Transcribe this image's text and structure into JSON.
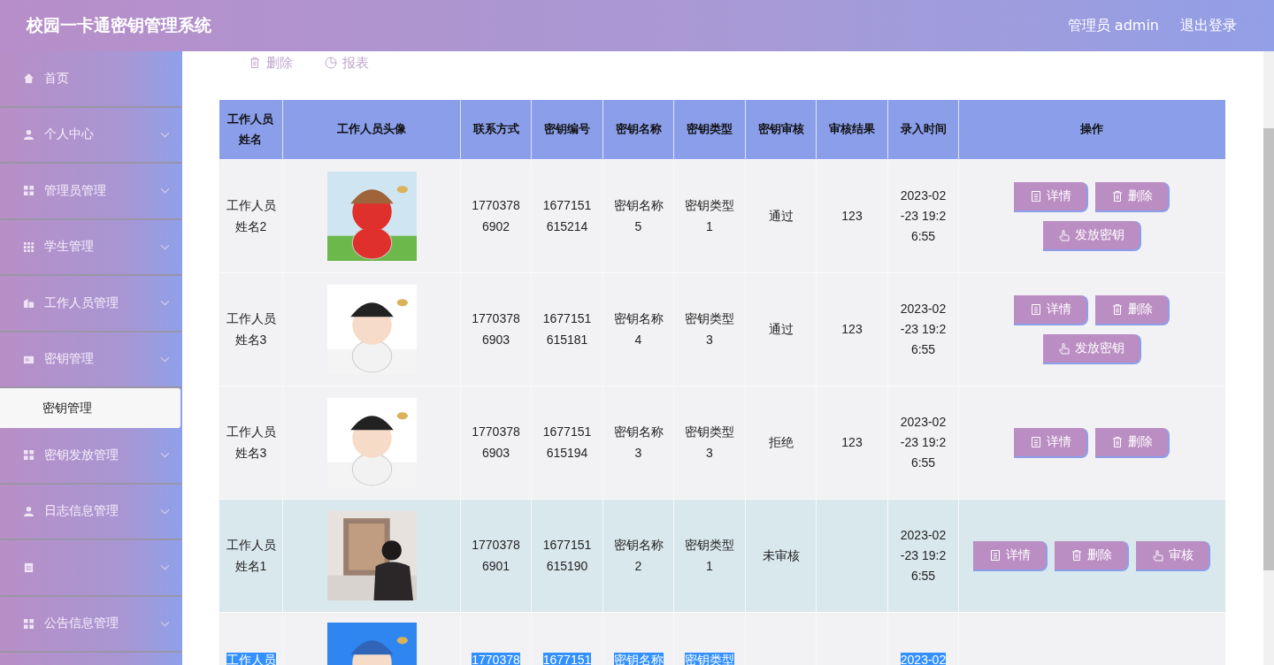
{
  "header": {
    "title": "校园一卡通密钥管理系统",
    "user": "管理员 admin",
    "logout": "退出登录"
  },
  "sidebar": {
    "items": [
      {
        "label": "首页",
        "kind": "link"
      },
      {
        "label": "个人中心",
        "kind": "menu"
      },
      {
        "label": "管理员管理",
        "kind": "menu"
      },
      {
        "label": "学生管理",
        "kind": "menu"
      },
      {
        "label": "工作人员管理",
        "kind": "menu"
      },
      {
        "label": "密钥管理",
        "kind": "menu",
        "children": [
          {
            "label": "密钥管理",
            "selected": true
          }
        ]
      },
      {
        "label": "密钥发放管理",
        "kind": "menu"
      },
      {
        "label": "日志信息管理",
        "kind": "menu"
      },
      {
        "kind": "menu"
      },
      {
        "label": "公告信息管理",
        "kind": "menu"
      }
    ]
  },
  "toolbar": [
    {
      "label": "删除",
      "kind": "delete"
    },
    {
      "label": "报表",
      "kind": "report"
    }
  ],
  "table": {
    "columns": [
      "工作人员姓名",
      "工作人员头像",
      "联系方式",
      "密钥编号",
      "密钥名称",
      "密钥类型",
      "密钥审核",
      "审核结果",
      "录入时间",
      "操作"
    ],
    "rows": [
      {
        "name": "工作人员姓名2",
        "contact": "17703786902",
        "key_no": "1677151615214",
        "key_name": "密钥名称5",
        "key_type": "密钥类型1",
        "review": "通过",
        "result": "123",
        "time": "2023-02-23 19:26:55",
        "hover": false,
        "text_selected": false,
        "actions": [
          {
            "label": "详情",
            "kind": "detail"
          },
          {
            "label": "删除",
            "kind": "delete"
          },
          {
            "label": "发放密钥",
            "kind": "issue"
          }
        ]
      },
      {
        "name": "工作人员姓名3",
        "contact": "17703786903",
        "key_no": "1677151615181",
        "key_name": "密钥名称4",
        "key_type": "密钥类型3",
        "review": "通过",
        "result": "123",
        "time": "2023-02-23 19:26:55",
        "hover": false,
        "text_selected": false,
        "actions": [
          {
            "label": "详情",
            "kind": "detail"
          },
          {
            "label": "删除",
            "kind": "delete"
          },
          {
            "label": "发放密钥",
            "kind": "issue"
          }
        ]
      },
      {
        "name": "工作人员姓名3",
        "contact": "17703786903",
        "key_no": "1677151615194",
        "key_name": "密钥名称3",
        "key_type": "密钥类型3",
        "review": "拒绝",
        "result": "123",
        "time": "2023-02-23 19:26:55",
        "hover": false,
        "text_selected": false,
        "actions": [
          {
            "label": "详情",
            "kind": "detail"
          },
          {
            "label": "删除",
            "kind": "delete"
          }
        ]
      },
      {
        "name": "工作人员姓名1",
        "contact": "17703786901",
        "key_no": "1677151615190",
        "key_name": "密钥名称2",
        "key_type": "密钥类型1",
        "review": "未审核",
        "time": "2023-02-23 19:26:55",
        "hover": true,
        "text_selected": false,
        "actions": [
          {
            "label": "详情",
            "kind": "detail"
          },
          {
            "label": "删除",
            "kind": "delete"
          },
          {
            "label": "审核",
            "kind": "review"
          }
        ]
      },
      {
        "name": "工作人员",
        "contact": "1770378",
        "key_no": "1677151",
        "key_name": "密钥名称",
        "key_type": "密钥类型",
        "time": "2023-02",
        "hover": false,
        "text_selected": true
      }
    ]
  }
}
